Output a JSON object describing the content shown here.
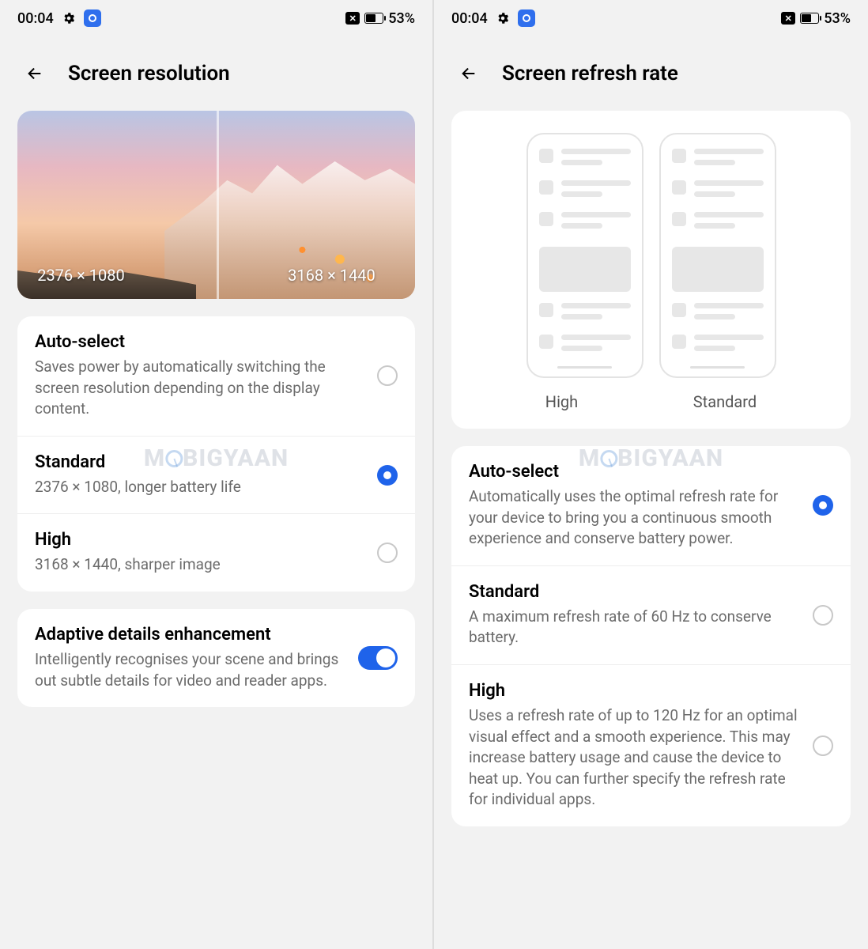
{
  "status_bar": {
    "time": "00:04",
    "battery": "53%"
  },
  "watermark": "MOBIGYAAN",
  "left": {
    "title": "Screen resolution",
    "preview": {
      "left_res": "2376 × 1080",
      "right_res": "3168 × 1440"
    },
    "options": [
      {
        "title": "Auto-select",
        "desc": "Saves power by automatically switching the screen resolution depending on the display content.",
        "selected": false
      },
      {
        "title": "Standard",
        "desc": "2376 × 1080, longer battery life",
        "selected": true
      },
      {
        "title": "High",
        "desc": "3168 × 1440, sharper image",
        "selected": false
      }
    ],
    "adaptive": {
      "title": "Adaptive details enhancement",
      "desc": "Intelligently recognises your scene and brings out subtle details for video and reader apps.",
      "enabled": true
    }
  },
  "right": {
    "title": "Screen refresh rate",
    "preview_labels": {
      "high": "High",
      "standard": "Standard"
    },
    "options": [
      {
        "title": "Auto-select",
        "desc": "Automatically uses the optimal refresh rate for your device to bring you a continuous smooth experience and conserve battery power.",
        "selected": true
      },
      {
        "title": "Standard",
        "desc": "A maximum refresh rate of 60 Hz to conserve battery.",
        "selected": false
      },
      {
        "title": "High",
        "desc": "Uses a refresh rate of up to 120 Hz for an optimal visual effect and a smooth experience. This may increase battery usage and cause the device to heat up. You can further specify the refresh rate for individual apps.",
        "selected": false
      }
    ]
  }
}
